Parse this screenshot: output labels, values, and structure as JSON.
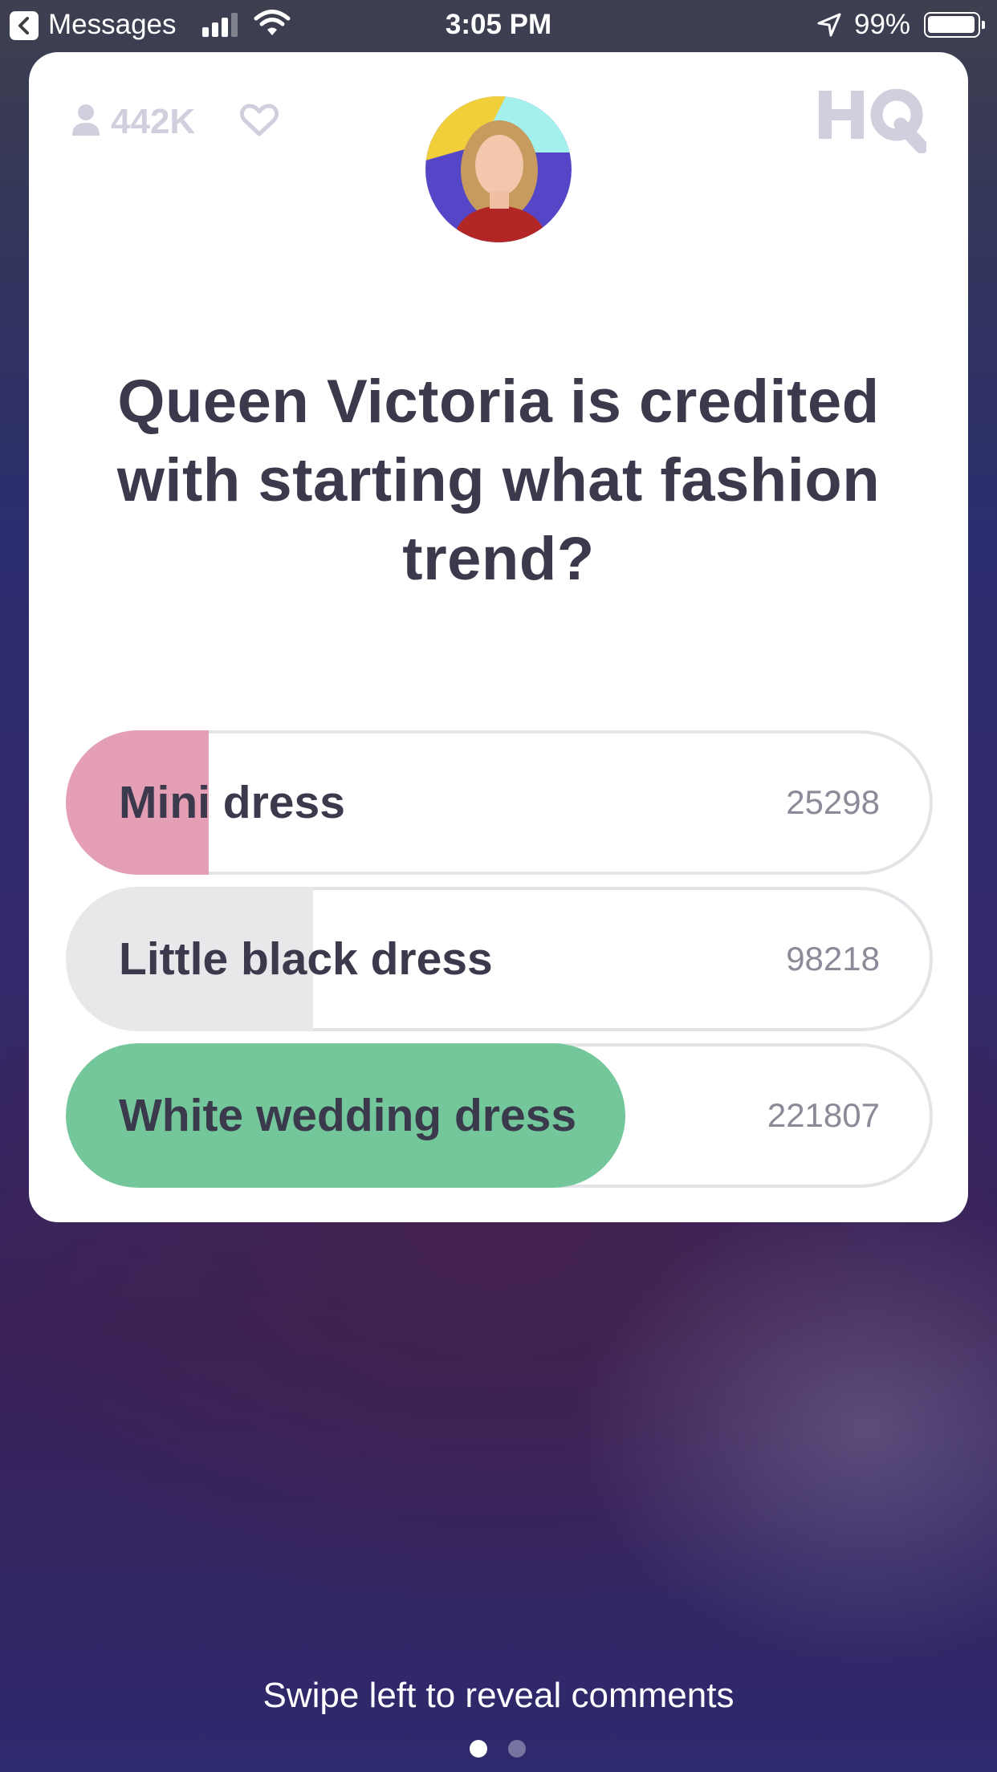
{
  "status_bar": {
    "back_label": "Messages",
    "time": "3:05 PM",
    "battery": "99%"
  },
  "header": {
    "viewer_count": "442K",
    "logo": "HQ"
  },
  "question": {
    "text": "Queen Victoria is credited with starting what fashion trend?"
  },
  "answers": [
    {
      "label": "Mini dress",
      "count": "25298",
      "fill_fraction": 0.165,
      "fill_color": "#e59fb5"
    },
    {
      "label": "Little black dress",
      "count": "98218",
      "fill_fraction": 0.285,
      "fill_color": "#e8e8eb"
    },
    {
      "label": "White wedding dress",
      "count": "221807",
      "fill_fraction": 0.645,
      "fill_color": "#74c79a"
    }
  ],
  "footer": {
    "swipe_hint": "Swipe left to reveal comments",
    "page_dots": 2,
    "active_dot": 0
  },
  "colors": {
    "correct": "#74c79a",
    "selected_wrong": "#e59fb5",
    "text": "#3a3a4c",
    "muted": "#d0cfde"
  }
}
